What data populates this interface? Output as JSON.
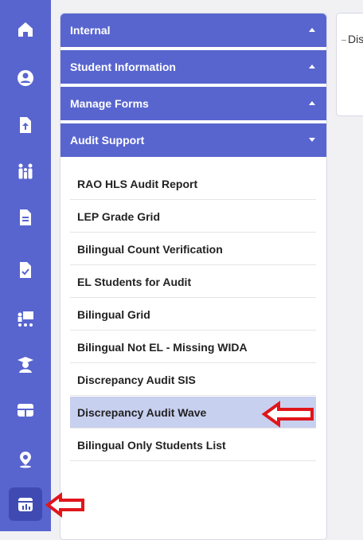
{
  "colors": {
    "accent": "#5865cf",
    "selected": "#c8d0f0",
    "arrow": "#e0161b"
  },
  "rail_icons": [
    "home-icon",
    "user-circle-icon",
    "file-upload-icon",
    "family-icon",
    "document-icon",
    "document-check-icon",
    "classroom-icon",
    "graduate-icon",
    "grid-table-icon",
    "location-pin-icon",
    "calendar-chart-icon"
  ],
  "sections": [
    {
      "label": "Internal",
      "expanded": false
    },
    {
      "label": "Student Information",
      "expanded": false
    },
    {
      "label": "Manage Forms",
      "expanded": false
    },
    {
      "label": "Audit Support",
      "expanded": true
    }
  ],
  "audit_items": [
    "RAO HLS Audit Report",
    "LEP Grade Grid",
    "Bilingual Count Verification",
    "EL Students for Audit",
    "Bilingual Grid",
    "Bilingual Not EL - Missing WIDA",
    "Discrepancy Audit SIS",
    "Discrepancy Audit Wave",
    "Bilingual Only Students List"
  ],
  "selected_item": "Discrepancy Audit Wave",
  "card": {
    "label": "Dis"
  }
}
